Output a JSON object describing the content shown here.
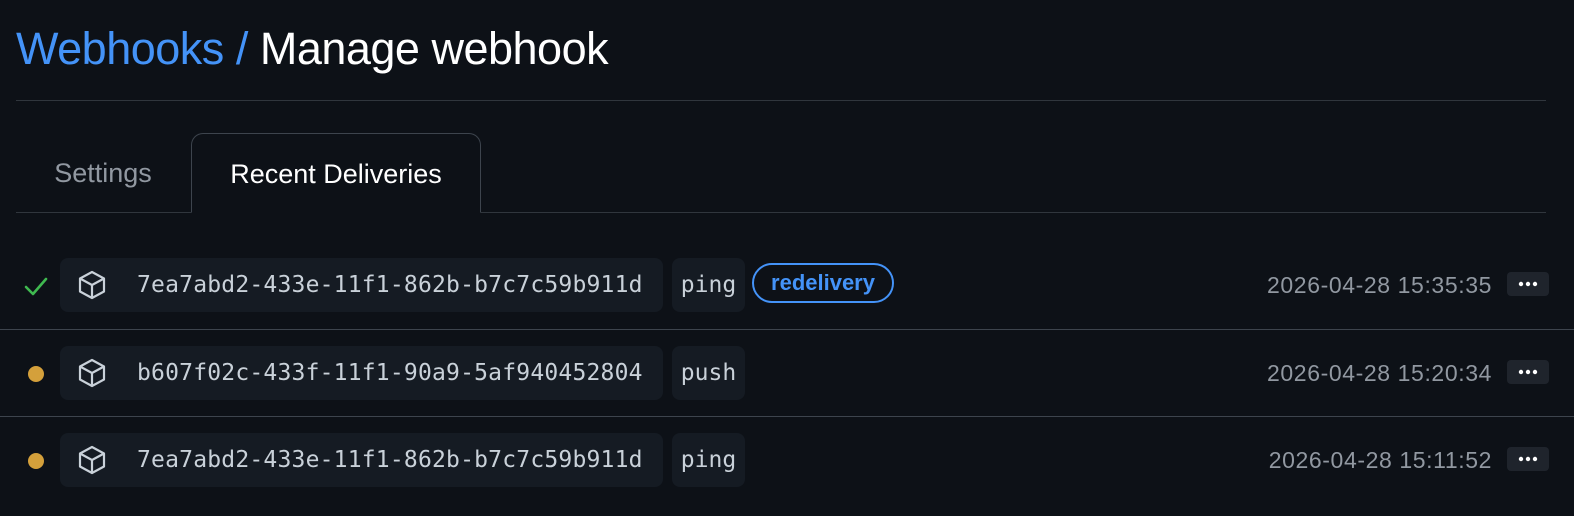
{
  "breadcrumb": {
    "parent": "Webhooks",
    "separator": "/",
    "current": "Manage webhook"
  },
  "tabs": [
    {
      "label": "Settings",
      "active": false
    },
    {
      "label": "Recent Deliveries",
      "active": true
    }
  ],
  "deliveries": [
    {
      "status": "success",
      "guid": "7ea7abd2-433e-11f1-862b-b7c7c59b911d",
      "event": "ping",
      "badge": "redelivery",
      "timestamp": "2026-04-28 15:35:35"
    },
    {
      "status": "pending",
      "guid": "b607f02c-433f-11f1-90a9-5af940452804",
      "event": "push",
      "badge": null,
      "timestamp": "2026-04-28 15:20:34"
    },
    {
      "status": "pending",
      "guid": "7ea7abd2-433e-11f1-862b-b7c7c59b911d",
      "event": "ping",
      "badge": null,
      "timestamp": "2026-04-28 15:11:52"
    }
  ],
  "icons": {
    "success": "check-icon",
    "pending": "dot-icon",
    "package": "package-icon",
    "more": "kebab-horizontal-icon"
  },
  "colors": {
    "link": "#4493f8",
    "success": "#3fb950",
    "pending": "#d4a03b",
    "background": "#0d1117"
  }
}
